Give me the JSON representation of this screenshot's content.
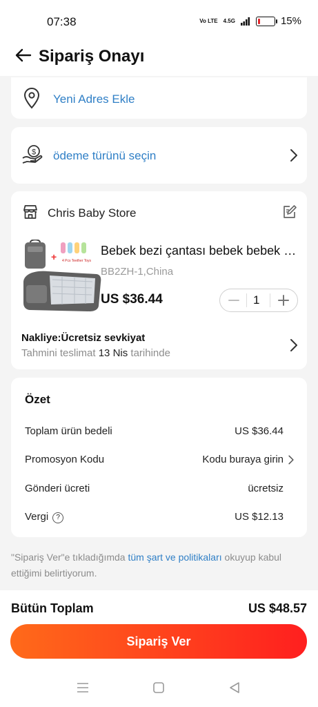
{
  "status_bar": {
    "time": "07:38",
    "volte_label": "Vo LTE",
    "signal_label": "4.5G",
    "battery_percent": "15%",
    "battery_level": 0.15,
    "battery_color": "#e3262c"
  },
  "header": {
    "title": "Sipariş Onayı",
    "back_icon": "arrow-left-icon"
  },
  "address": {
    "label": "Yeni Adres Ekle",
    "icon": "location-pin-icon"
  },
  "payment": {
    "label": "ödeme türünü seçin",
    "icon": "payment-hand-coin-icon"
  },
  "store": {
    "name": "Chris Baby Store",
    "icon": "store-icon",
    "edit_icon": "note-edit-icon",
    "product": {
      "title": "Bebek bezi çantası bebek bebek d...",
      "sku": "BB2ZH-1,China",
      "price": "US $36.44",
      "quantity": "1",
      "image_label": "4 Pcs Teether Toys"
    },
    "shipping": {
      "title": "Nakliye:Ücretsiz sevkiyat",
      "eta_prefix": "Tahmini teslimat",
      "eta_date": "13 Nis",
      "eta_suffix": "tarihinde"
    }
  },
  "summary": {
    "title": "Özet",
    "rows": [
      {
        "label": "Toplam ürün bedeli",
        "value": "US $36.44"
      },
      {
        "label": "Promosyon Kodu",
        "value": "Kodu buraya girin"
      },
      {
        "label": "Gönderi ücreti",
        "value": "ücretsiz"
      },
      {
        "label": "Vergi",
        "value": "US $12.13"
      }
    ]
  },
  "terms": {
    "prefix": "\"Sipariş Ver\"e tıkladığımda",
    "link": "tüm şart ve politikaları",
    "suffix": "okuyup kabul ettiğimi belirtiyorum."
  },
  "footer": {
    "total_label": "Bütün Toplam",
    "total_value": "US $48.57",
    "button_label": "Sipariş Ver",
    "button_colors": [
      "#ff6a1a",
      "#ff1f1f"
    ]
  },
  "colors": {
    "link": "#2f7fc6",
    "background": "#f4f4f4"
  }
}
